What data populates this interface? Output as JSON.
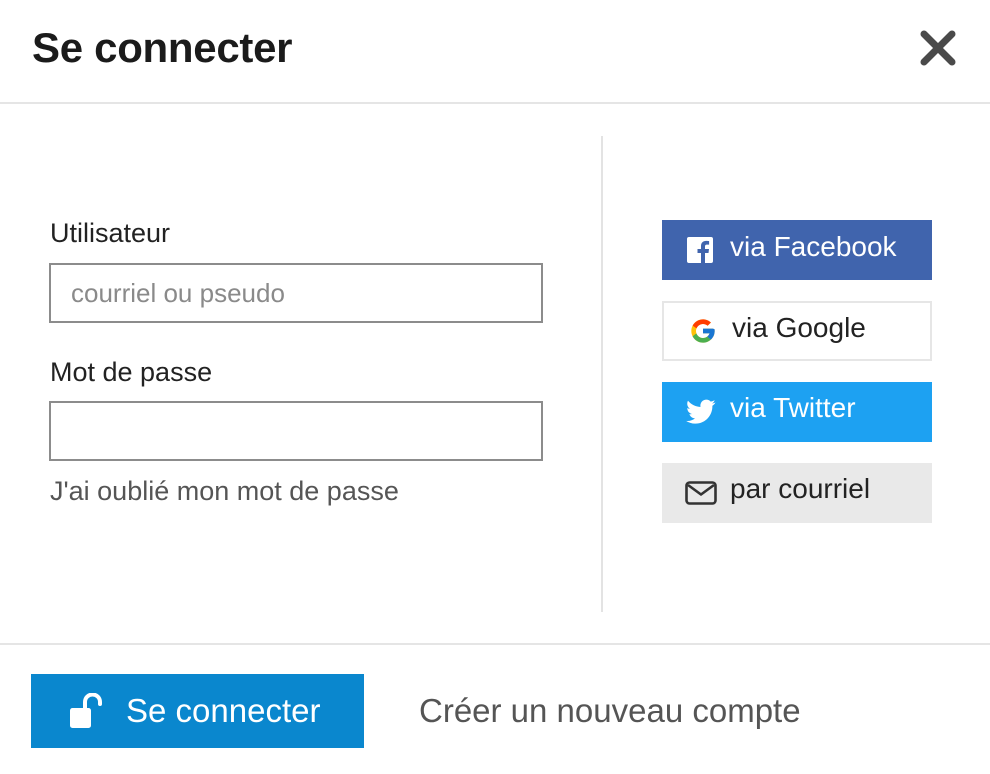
{
  "dialog": {
    "title": "Se connecter",
    "close_icon": "close-icon"
  },
  "form": {
    "username_label": "Utilisateur",
    "username_placeholder": "courriel ou pseudo",
    "username_value": "",
    "password_label": "Mot de passe",
    "password_value": "",
    "forgot_link": "J'ai oublié mon mot de passe"
  },
  "social": {
    "facebook": {
      "label": "via Facebook",
      "icon": "facebook-icon",
      "color": "#4064ad"
    },
    "google": {
      "label": "via Google",
      "icon": "google-icon",
      "color": "#ffffff"
    },
    "twitter": {
      "label": "via Twitter",
      "icon": "twitter-icon",
      "color": "#1da1f2"
    },
    "email": {
      "label": "par courriel",
      "icon": "envelope-icon",
      "color": "#e9e9e9"
    }
  },
  "footer": {
    "submit_label": "Se connecter",
    "submit_icon": "unlock-icon",
    "submit_color": "#0a87ce",
    "create_account_link": "Créer un nouveau compte"
  }
}
